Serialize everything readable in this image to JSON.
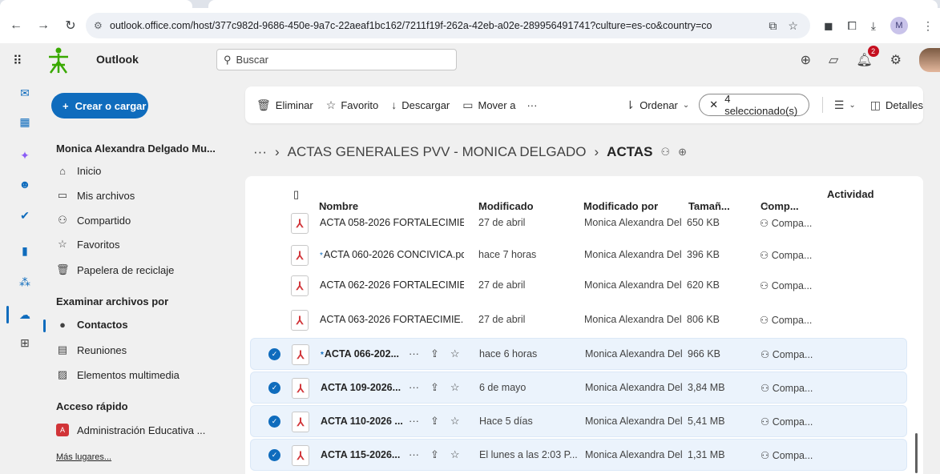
{
  "browser": {
    "url": "outlook.office.com/host/377c982d-9686-450e-9a7c-22aeaf1bc162/7211f19f-262a-42eb-a02e-289956491741?culture=es-co&country=co",
    "profile_initial": "M"
  },
  "app": {
    "name": "Outlook",
    "org_label": "SENA",
    "search_placeholder": "Buscar",
    "notification_count": "2"
  },
  "leftnav": {
    "create_label": "Crear o cargar",
    "owner": "Monica Alexandra Delgado Mu...",
    "items": [
      {
        "label": "Inicio",
        "icon": "home-icon"
      },
      {
        "label": "Mis archivos",
        "icon": "folder-icon"
      },
      {
        "label": "Compartido",
        "icon": "people-icon"
      },
      {
        "label": "Favoritos",
        "icon": "star-icon"
      },
      {
        "label": "Papelera de reciclaje",
        "icon": "trash-icon"
      }
    ],
    "browse_title": "Examinar archivos por",
    "browse_items": [
      {
        "label": "Contactos",
        "icon": "contact-icon"
      },
      {
        "label": "Reuniones",
        "icon": "calendar-icon"
      },
      {
        "label": "Elementos multimedia",
        "icon": "image-icon"
      }
    ],
    "quick_title": "Acceso rápido",
    "quick_items": [
      {
        "label": "Administración Educativa ...",
        "icon_letter": "A"
      }
    ],
    "more_places": "Más lugares..."
  },
  "toolbar": {
    "delete": "Eliminar",
    "favorite": "Favorito",
    "download": "Descargar",
    "move": "Mover a",
    "more": "···",
    "sort": "Ordenar",
    "selected": "4 seleccionado(s)",
    "details": "Detalles"
  },
  "breadcrumb": {
    "ellipsis": "···",
    "parent": "ACTAS GENERALES PVV - MONICA DELGADO",
    "current": "ACTAS"
  },
  "columns": {
    "name": "Nombre",
    "modified": "Modificado",
    "modified_by": "Modificado por",
    "size": "Tamañ...",
    "shared": "Comp...",
    "activity": "Actividad"
  },
  "files": [
    {
      "name": "ACTA 058-2026 FORTALECIMIE...",
      "modified": "27 de abril",
      "by": "Monica Alexandra Delg",
      "size": "650 KB",
      "shared": "Compa...",
      "selected": false,
      "new": false
    },
    {
      "name": "ACTA 060-2026 CONCIVICA.pdf",
      "modified": "hace 7 horas",
      "by": "Monica Alexandra Delg",
      "size": "396 KB",
      "shared": "Compa...",
      "selected": false,
      "new": true
    },
    {
      "name": "ACTA 062-2026 FORTALECIMIE...",
      "modified": "27 de abril",
      "by": "Monica Alexandra Delg",
      "size": "620 KB",
      "shared": "Compa...",
      "selected": false,
      "new": false
    },
    {
      "name": "ACTA 063-2026 FORTAECIMIE...",
      "modified": "27 de abril",
      "by": "Monica Alexandra Delg",
      "size": "806 KB",
      "shared": "Compa...",
      "selected": false,
      "new": false
    },
    {
      "name": "ACTA 066-202...",
      "modified": "hace 6 horas",
      "by": "Monica Alexandra Delg",
      "size": "966 KB",
      "shared": "Compa...",
      "selected": true,
      "new": true
    },
    {
      "name": "ACTA 109-2026...",
      "modified": "6 de mayo",
      "by": "Monica Alexandra Delg",
      "size": "3,84 MB",
      "shared": "Compa...",
      "selected": true,
      "new": false
    },
    {
      "name": "ACTA 110-2026 ...",
      "modified": "Hace 5 días",
      "by": "Monica Alexandra Delg",
      "size": "5,41 MB",
      "shared": "Compa...",
      "selected": true,
      "new": false
    },
    {
      "name": "ACTA 115-2026...",
      "modified": "El lunes a las 2:03 P...",
      "by": "Monica Alexandra Delg",
      "size": "1,31 MB",
      "shared": "Compa...",
      "selected": true,
      "new": false
    }
  ],
  "colors": {
    "accent": "#0f6cbd",
    "selected_row": "#ebf3fc",
    "pdf_red": "#d13438"
  }
}
